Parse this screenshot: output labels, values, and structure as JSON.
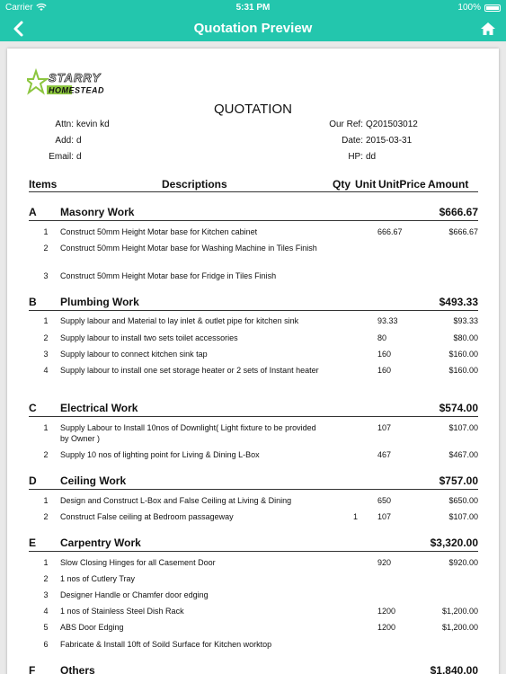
{
  "status_bar": {
    "carrier": "Carrier",
    "time": "5:31 PM",
    "battery": "100%"
  },
  "nav": {
    "title": "Quotation Preview",
    "back_icon": "chevron-left-icon",
    "home_icon": "home-icon"
  },
  "colors": {
    "accent": "#23c6ad",
    "logo_green": "#8cc63f"
  },
  "logo": {
    "line1": "STARRY",
    "line2": "HOMESTEAD"
  },
  "document": {
    "title": "QUOTATION",
    "attn_label": "Attn:",
    "attn": "kevin kd",
    "add_label": "Add:",
    "add": "d",
    "email_label": "Email:",
    "email": "d",
    "ref_label": "Our Ref:",
    "ref": "Q201503012",
    "date_label": "Date:",
    "date": "2015-03-31",
    "hp_label": "HP:",
    "hp": "dd"
  },
  "table_headers": {
    "items": "Items",
    "descriptions": "Descriptions",
    "qty": "Qty",
    "unit": "Unit",
    "unitprice": "UnitPrice",
    "amount": "Amount"
  },
  "sections": [
    {
      "letter": "A",
      "name": "Masonry Work",
      "total": "$666.67",
      "items": [
        {
          "no": "1",
          "desc": "Construct 50mm Height Motar base for Kitchen cabinet",
          "qty": "",
          "unitprice": "666.67",
          "amount": "$666.67"
        },
        {
          "no": "2",
          "desc": "Construct 50mm Height Motar base for Washing Machine in Tiles Finish",
          "qty": "",
          "unitprice": "",
          "amount": ""
        },
        {
          "no": "3",
          "desc": "Construct 50mm Height Motar base for Fridge in Tiles Finish",
          "qty": "",
          "unitprice": "",
          "amount": ""
        }
      ]
    },
    {
      "letter": "B",
      "name": "Plumbing Work",
      "total": "$493.33",
      "items": [
        {
          "no": "1",
          "desc": "Supply labour and Material to lay inlet & outlet pipe for kitchen sink",
          "qty": "",
          "unitprice": "93.33",
          "amount": "$93.33"
        },
        {
          "no": "2",
          "desc": "Supply labour to install two sets toilet accessories",
          "qty": "",
          "unitprice": "80",
          "amount": "$80.00"
        },
        {
          "no": "3",
          "desc": "Supply labour to connect kitchen sink tap",
          "qty": "",
          "unitprice": "160",
          "amount": "$160.00"
        },
        {
          "no": "4",
          "desc": "Supply labour to install one set storage heater or 2 sets of Instant heater",
          "qty": "",
          "unitprice": "160",
          "amount": "$160.00"
        }
      ]
    },
    {
      "letter": "C",
      "name": "Electrical Work",
      "total": "$574.00",
      "items": [
        {
          "no": "1",
          "desc": "Supply Labour to Install 10nos of Downlight( Light fixture to be provided by Owner )",
          "qty": "",
          "unitprice": "107",
          "amount": "$107.00"
        },
        {
          "no": "2",
          "desc": "Supply 10 nos of lighting point for Living & Dining L-Box",
          "qty": "",
          "unitprice": "467",
          "amount": "$467.00"
        }
      ]
    },
    {
      "letter": "D",
      "name": "Ceiling Work",
      "total": "$757.00",
      "items": [
        {
          "no": "1",
          "desc": "Design and Construct L-Box and False Ceiling at Living & Dining",
          "qty": "",
          "unitprice": "650",
          "amount": "$650.00"
        },
        {
          "no": "2",
          "desc": "Construct False ceiling at Bedroom passageway",
          "qty": "1",
          "unitprice": "107",
          "amount": "$107.00"
        }
      ]
    },
    {
      "letter": "E",
      "name": "Carpentry Work",
      "total": "$3,320.00",
      "items": [
        {
          "no": "1",
          "desc": "Slow Closing Hinges for all Casement Door",
          "qty": "",
          "unitprice": "920",
          "amount": "$920.00"
        },
        {
          "no": "2",
          "desc": "1 nos of Cutlery Tray",
          "qty": "",
          "unitprice": "",
          "amount": ""
        },
        {
          "no": "3",
          "desc": "Designer Handle or Chamfer door edging",
          "qty": "",
          "unitprice": "",
          "amount": ""
        },
        {
          "no": "4",
          "desc": "1 nos of Stainless Steel Dish Rack",
          "qty": "",
          "unitprice": "1200",
          "amount": "$1,200.00"
        },
        {
          "no": "5",
          "desc": "ABS Door Edging",
          "qty": "",
          "unitprice": "1200",
          "amount": "$1,200.00"
        },
        {
          "no": "6",
          "desc": "Fabricate & Install 10ft of Soild Surface for Kitchen worktop",
          "qty": "",
          "unitprice": "",
          "amount": ""
        }
      ]
    },
    {
      "letter": "F",
      "name": "Others",
      "total": "$1,840.00",
      "items": []
    }
  ]
}
